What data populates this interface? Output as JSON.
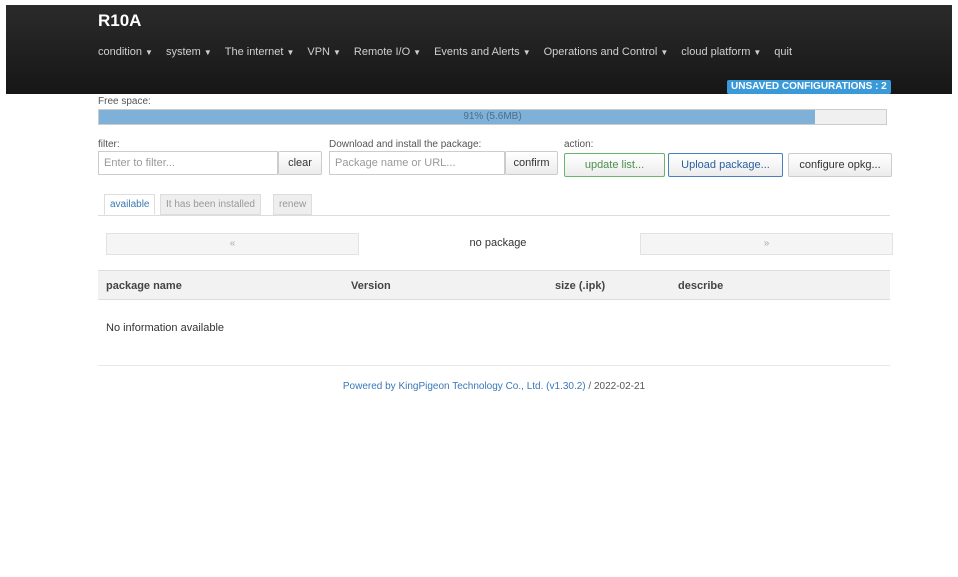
{
  "header": {
    "brand": "R10A",
    "unsaved_badge": "UNSAVED CONFIGURATIONS : 2",
    "menu": [
      {
        "label": "condition",
        "has_dropdown": true
      },
      {
        "label": "system",
        "has_dropdown": true
      },
      {
        "label": "The internet",
        "has_dropdown": true
      },
      {
        "label": "VPN",
        "has_dropdown": true
      },
      {
        "label": "Remote I/O",
        "has_dropdown": true
      },
      {
        "label": "Events and Alerts",
        "has_dropdown": true
      },
      {
        "label": "Operations and Control",
        "has_dropdown": true
      },
      {
        "label": "cloud platform",
        "has_dropdown": true
      },
      {
        "label": "quit",
        "has_dropdown": false
      }
    ]
  },
  "free_space": {
    "label": "Free space:",
    "text": "91% (5.6MB)",
    "percent": 91
  },
  "filter": {
    "label": "filter:",
    "placeholder": "Enter to filter...",
    "value": "",
    "clear_label": "clear"
  },
  "install": {
    "label": "Download and install the package:",
    "placeholder": "Package name or URL...",
    "value": "",
    "confirm_label": "confirm"
  },
  "action": {
    "label": "action:",
    "update_label": "update list...",
    "upload_label": "Upload package...",
    "configure_label": "configure opkg..."
  },
  "tabs": [
    {
      "label": "available",
      "active": true
    },
    {
      "label": "It has been installed",
      "active": false
    },
    {
      "label": "renew",
      "active": false
    }
  ],
  "pager": {
    "prev": "«",
    "next": "»",
    "status": "no package"
  },
  "table": {
    "columns": [
      "package name",
      "Version",
      "size (.ipk)",
      "describe"
    ],
    "empty_text": "No information available"
  },
  "footer": {
    "link_text": "Powered by KingPigeon Technology Co., Ltd. (v1.30.2)",
    "suffix": " / 2022-02-21"
  },
  "colors": {
    "accent": "#3a78b8",
    "badge": "#3a9ad9",
    "progress_fill": "#7fb0d8",
    "navbar": "#1e1e1e"
  }
}
